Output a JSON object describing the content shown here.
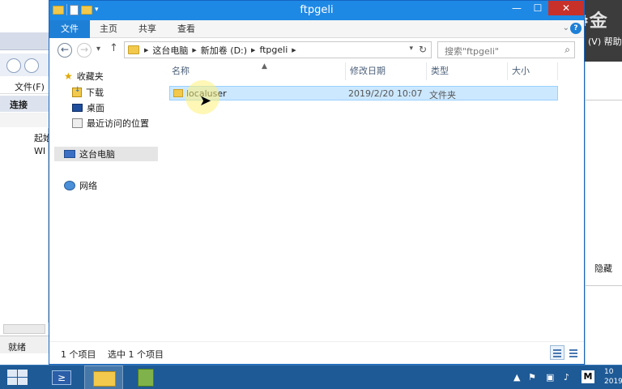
{
  "background_app": {
    "menu_file": "文件(F)",
    "connections_header": "连接",
    "tree_items": [
      "起始",
      "WI"
    ],
    "status": "就绪",
    "right_menu": "(V)  帮助",
    "right_action": "隐藏"
  },
  "watermark": "金",
  "explorer": {
    "title": "ftpgeli",
    "ribbon_tabs": [
      "文件",
      "主页",
      "共享",
      "查看"
    ],
    "address_crumbs": [
      "这台电脑",
      "新加卷 (D:)",
      "ftpgeli"
    ],
    "search_placeholder": "搜索\"ftpgeli\"",
    "nav": {
      "favorites": "收藏夹",
      "downloads": "下载",
      "desktop": "桌面",
      "recent": "最近访问的位置",
      "this_pc": "这台电脑",
      "network": "网络"
    },
    "columns": [
      "名称",
      "修改日期",
      "类型",
      "大小"
    ],
    "files": [
      {
        "name": "localuser",
        "modified": "2019/2/20 10:07",
        "type": "文件夹",
        "size": ""
      }
    ],
    "status_items": "1 个项目",
    "status_selected": "选中 1 个项目"
  },
  "taskbar": {
    "tray_m": "M",
    "clock_time": "10",
    "clock_date": "2019"
  }
}
